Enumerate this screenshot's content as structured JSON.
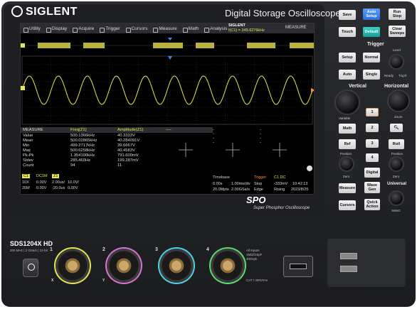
{
  "brand": "SIGLENT",
  "device_title": "Digital Storage Oscilloscope",
  "menu": [
    "Utility",
    "Display",
    "Acquire",
    "Trigger",
    "Cursors",
    "Measure",
    "Math",
    "Analysis"
  ],
  "siglent_tag": {
    "brand": "SIGLENT",
    "freq": "f(C1) = 249.6276kHz"
  },
  "measure_button": "MEASURE",
  "measure_table": {
    "headers": [
      "MEASURE",
      "Freq(Z1)",
      "Amplitude(Z1)",
      "----",
      "----",
      "----"
    ],
    "rows": [
      {
        "label": "Value",
        "freq": "500.1366kHz",
        "amp": "40.3333V"
      },
      {
        "label": "Mean",
        "freq": "500.02865kHz",
        "amp": "40.284091V"
      },
      {
        "label": "Min",
        "freq": "499.2717kHz",
        "amp": "39.6667V"
      },
      {
        "label": "Max",
        "freq": "500.6258kHz",
        "amp": "40.4583V"
      },
      {
        "label": "Pk-Pk",
        "freq": "1.354100kHz",
        "amp": "791.600mV"
      },
      {
        "label": "Stdev",
        "freq": "285.460Hz",
        "amp": "199.287mV"
      },
      {
        "label": "Count",
        "freq": "94",
        "amp": "11"
      }
    ]
  },
  "channels_info": {
    "labels": [
      "C1",
      "DC1M",
      "Z1"
    ],
    "row1": [
      "10X",
      "0.00V",
      "2.00us/",
      "10.0V/"
    ],
    "row2": [
      "20M",
      "0.00V",
      "-20.0us",
      "0.00V"
    ]
  },
  "timebase": {
    "label": "Timebase",
    "delay": "0.00s",
    "scale": "1.00ms/div",
    "mpts": "20.0Mpts",
    "rate": "2.00GSa/s"
  },
  "trigger": {
    "label": "Trigger",
    "source": "C1 DC",
    "mode": "Stop",
    "level": "-333mV",
    "type": "Edge",
    "slope": "Rising"
  },
  "clock": {
    "time": "10:42:13",
    "date": "2023/8/25"
  },
  "spo": {
    "logo": "SPO",
    "caption": "Super Phosphor Oscilloscope"
  },
  "panel": {
    "save": "Save",
    "auto_setup": "Auto\nSetup",
    "run_stop": "Run\nStop",
    "touch": "Touch",
    "default": "Default",
    "clear_sweeps": "Clear\nSweeps",
    "trigger_title": "Trigger",
    "setup": "Setup",
    "normal": "Normal",
    "auto": "Auto",
    "single": "Single",
    "level": "Level",
    "ready": "Ready",
    "trigd": "Trig'd",
    "vertical_title": "Vertical",
    "horizontal_title": "Horizontal",
    "variable": "Variable",
    "zoom": "Zoom",
    "position": "Position",
    "zero": "Zero",
    "ch_buttons": [
      "1",
      "2",
      "3",
      "4"
    ],
    "math": "Math",
    "ref": "Ref",
    "digital": "Digital",
    "measure": "Measure",
    "cursors": "Cursors",
    "search": "Search",
    "roll": "Roll",
    "history": "History",
    "wave_gen": "Wave\nGen",
    "quick_action": "Quick\nAction",
    "universal_title": "Universal",
    "select": "Select"
  },
  "front": {
    "model": "SDS1204X HD",
    "model_sub": "200 MHz | 2 GSa/s | 12-bit",
    "channels": [
      "1",
      "2",
      "3",
      "4"
    ],
    "ch_marks": [
      "X",
      "Y"
    ],
    "inputs_note": "All Inputs\n1MΩ//15pF\n400Vpk",
    "cat_note": "CAT I 400Vrms"
  },
  "colors": {
    "ch1": "#e8e84a",
    "ch2": "#e070d8",
    "ch3": "#4ad7e8",
    "ch4": "#5ae06a",
    "accent": "#3a86ff"
  }
}
